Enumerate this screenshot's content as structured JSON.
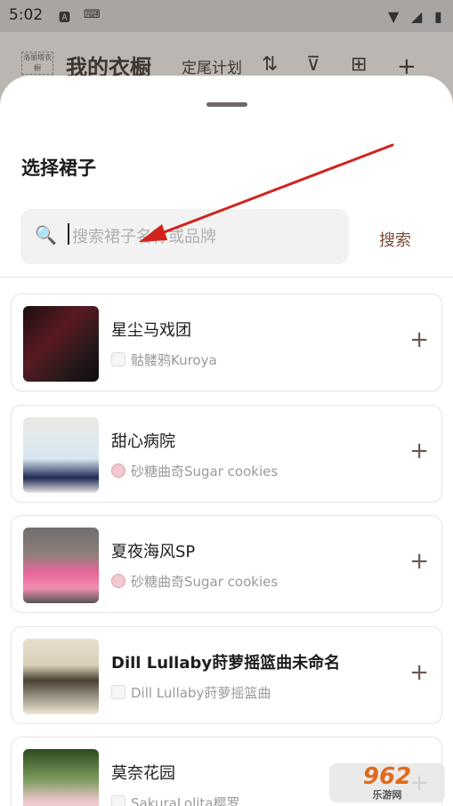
{
  "status_bar": {
    "time": "5:02"
  },
  "background_app": {
    "logo_text": "洛丽塔衣橱",
    "title": "我的衣橱",
    "plan_label": "定尾计划",
    "icons": [
      "sort-icon",
      "filter-icon",
      "grid-icon",
      "add-icon"
    ]
  },
  "sheet": {
    "title": "选择裙子",
    "search": {
      "placeholder": "搜索裙子名称或品牌",
      "button_label": "搜索"
    },
    "items": [
      {
        "name": "星尘马戏团",
        "brand": "骷髅鸦Kuroya"
      },
      {
        "name": "甜心病院",
        "brand": "砂糖曲奇Sugar cookies"
      },
      {
        "name": "夏夜海风SP",
        "brand": "砂糖曲奇Sugar cookies"
      },
      {
        "name": "Dill Lullaby莳萝摇篮曲未命名",
        "brand": "Dill Lullaby莳萝摇篮曲"
      },
      {
        "name": "莫奈花园",
        "brand": "SakuraLolita樱罗"
      }
    ]
  },
  "watermark": {
    "text": "962",
    "sub": "乐游网"
  },
  "colors": {
    "accent": "#7a4a3a",
    "arrow": "#d0231d"
  }
}
